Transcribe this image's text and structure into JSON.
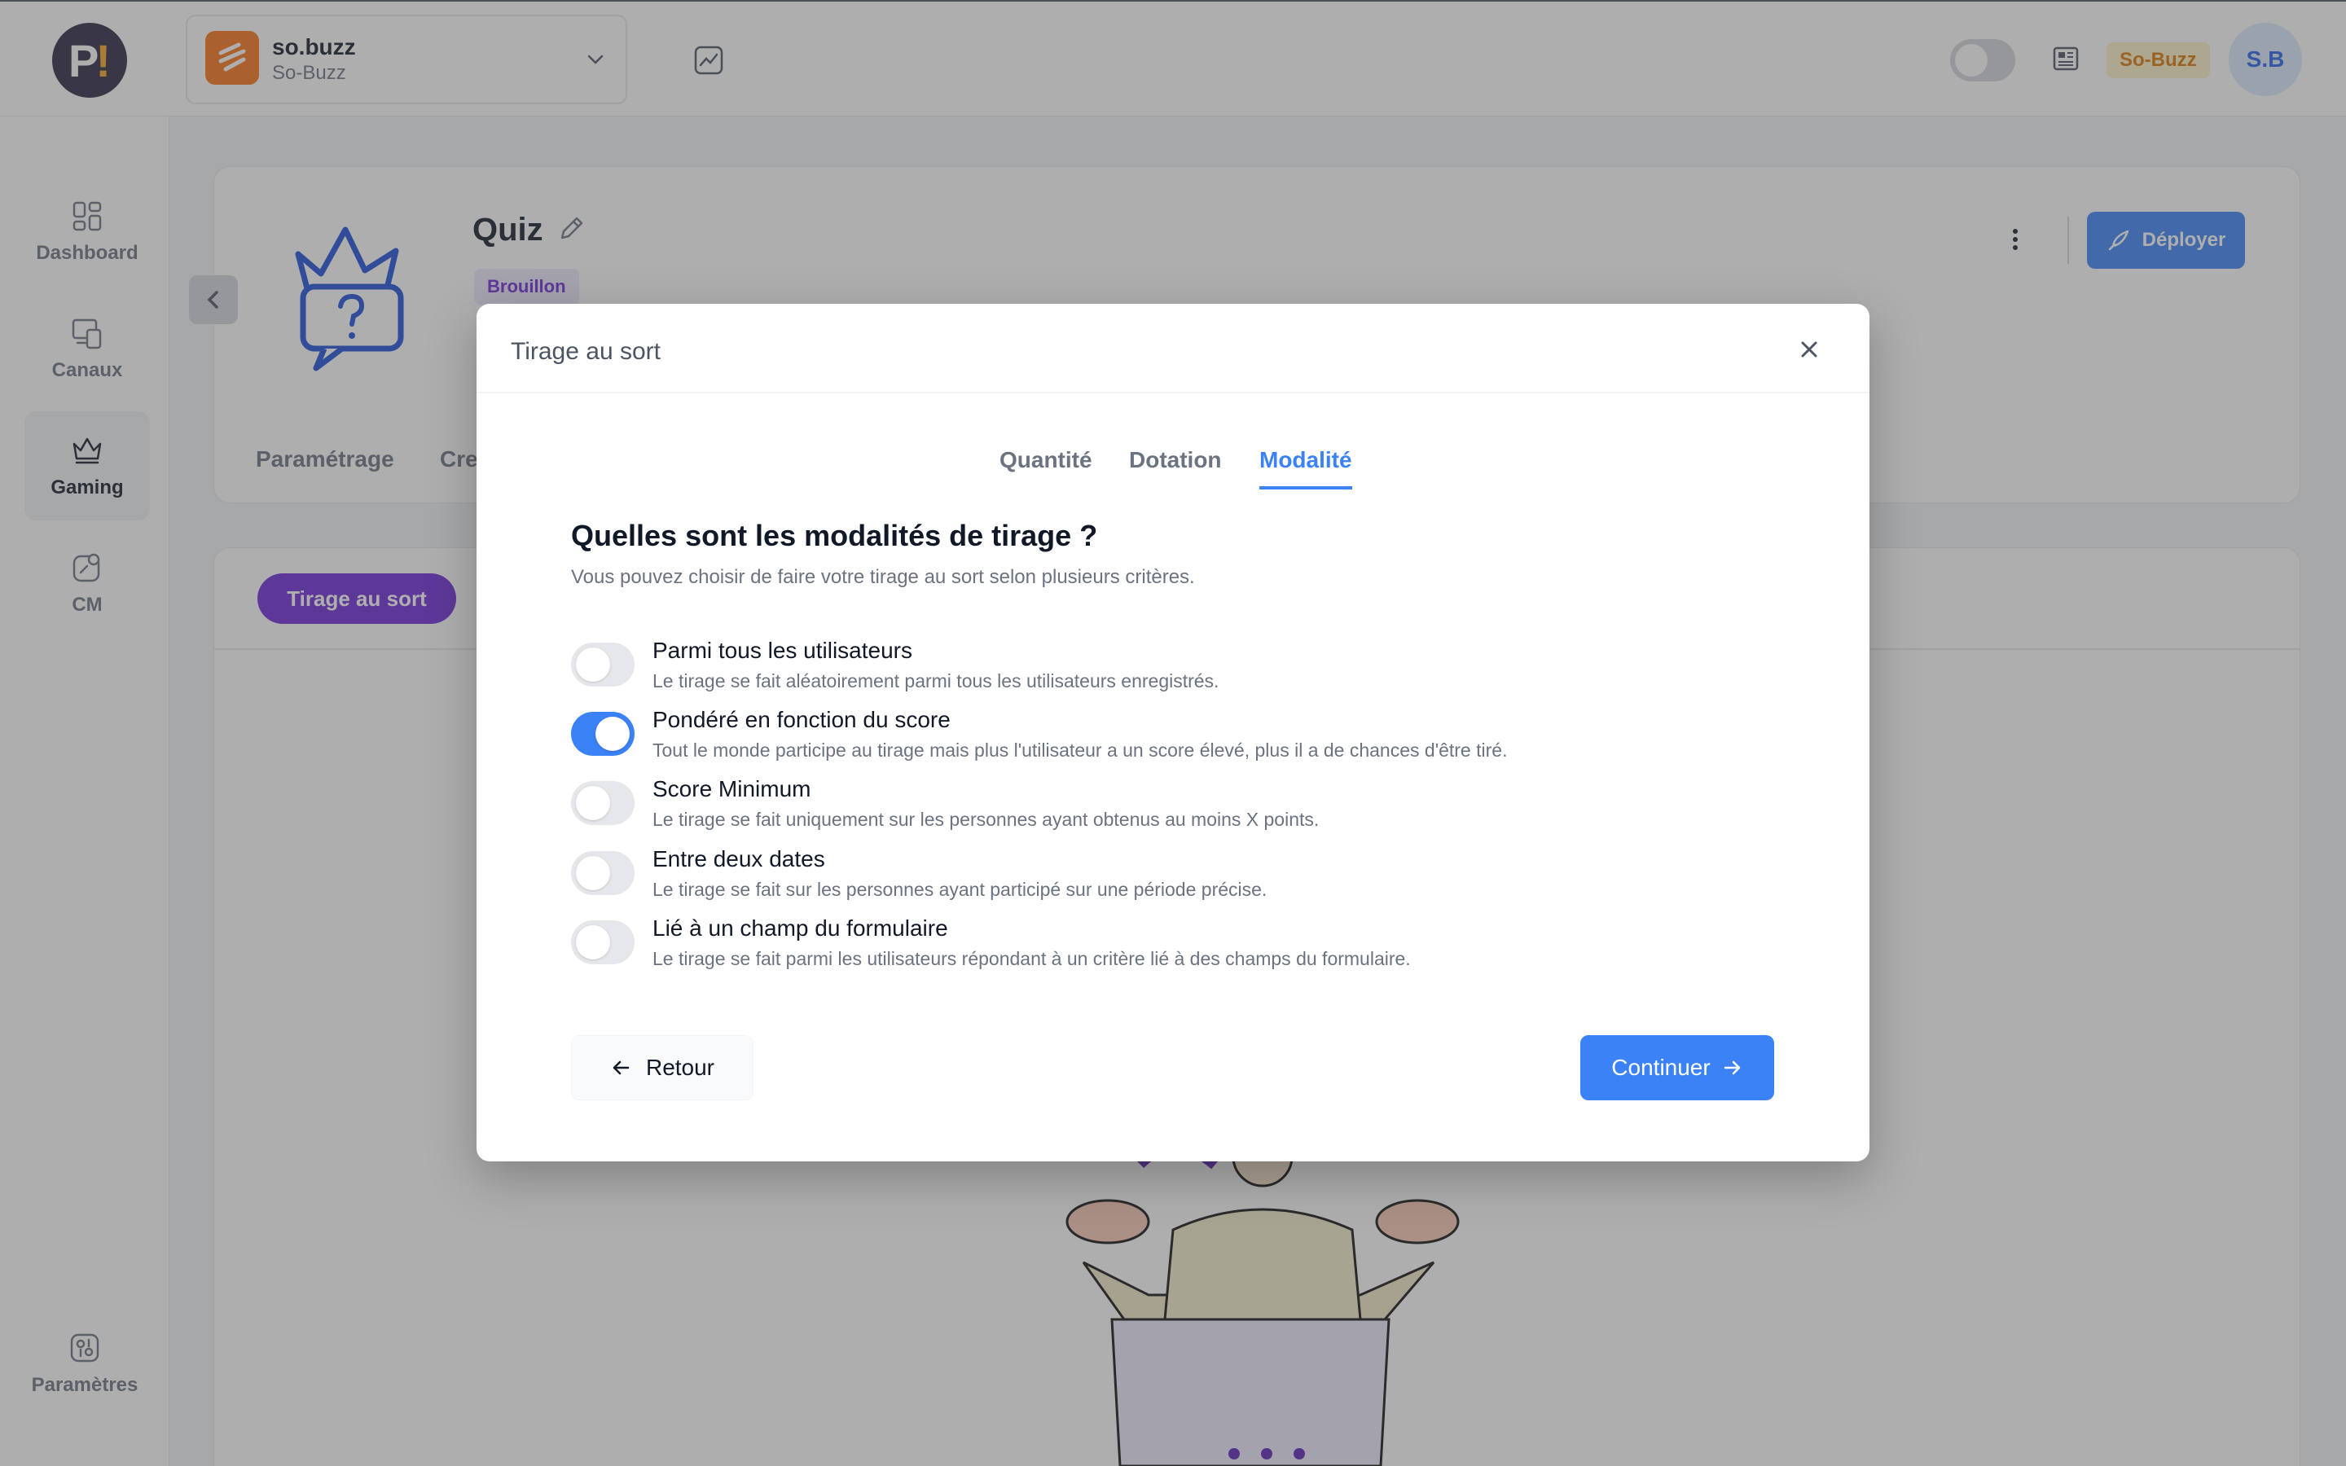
{
  "topbar": {
    "logo_letter": "P",
    "logo_mark": "!",
    "workspace_name": "so.buzz",
    "workspace_sub": "So-Buzz",
    "brand_badge": "So-Buzz",
    "avatar_initials": "S.B"
  },
  "sidebar": {
    "items": [
      {
        "label": "Dashboard",
        "icon": "dashboard-icon"
      },
      {
        "label": "Canaux",
        "icon": "devices-icon"
      },
      {
        "label": "Gaming",
        "icon": "crown-icon"
      },
      {
        "label": "CM",
        "icon": "edit-square-icon"
      },
      {
        "label": "Paramètres",
        "icon": "settings-icon"
      }
    ]
  },
  "page": {
    "title": "Quiz",
    "status": "Brouillon",
    "deploy_label": "Déployer",
    "tabs": [
      "Paramétrage",
      "Cre"
    ],
    "draw_button": "Tirage au sort"
  },
  "modal": {
    "title": "Tirage au sort",
    "tabs": [
      {
        "label": "Quantité",
        "active": false
      },
      {
        "label": "Dotation",
        "active": false
      },
      {
        "label": "Modalité",
        "active": true
      }
    ],
    "question": "Quelles sont les modalités de tirage ?",
    "question_sub": "Vous pouvez choisir de faire votre tirage au sort selon plusieurs critères.",
    "options": [
      {
        "title": "Parmi tous les utilisateurs",
        "desc": "Le tirage se fait aléatoirement parmi tous les utilisateurs enregistrés.",
        "enabled": false
      },
      {
        "title": "Pondéré en fonction du score",
        "desc": "Tout le monde participe au tirage mais plus l'utilisateur a un score élevé, plus il a de chances d'être tiré.",
        "enabled": true
      },
      {
        "title": "Score Minimum",
        "desc": "Le tirage se fait uniquement sur les personnes ayant obtenus au moins X points.",
        "enabled": false
      },
      {
        "title": "Entre deux dates",
        "desc": "Le tirage se fait sur les personnes ayant participé sur une période précise.",
        "enabled": false
      },
      {
        "title": "Lié à un champ du formulaire",
        "desc": "Le tirage se fait parmi les utilisateurs répondant à un critère lié à des champs du formulaire.",
        "enabled": false
      }
    ],
    "back_label": "Retour",
    "continue_label": "Continuer"
  },
  "colors": {
    "primary": "#3b82f6",
    "purple": "#6d28d9",
    "brand_orange": "#f97316",
    "overlay": "rgba(75,75,75,0.45)"
  }
}
